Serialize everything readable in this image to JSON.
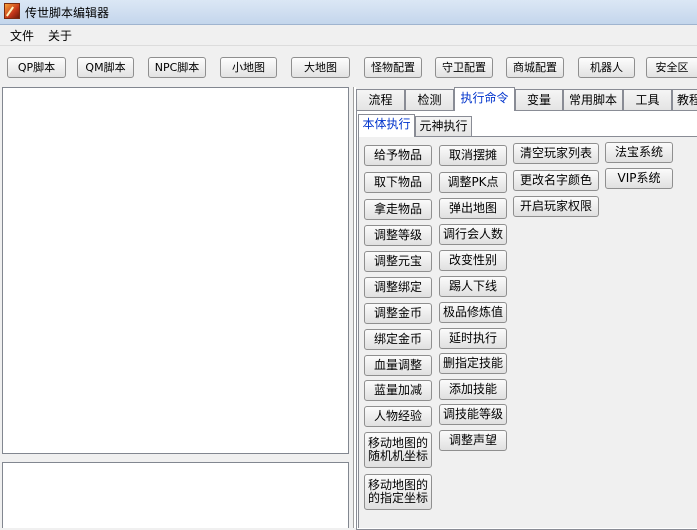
{
  "window": {
    "title": "传世脚本编辑器"
  },
  "menu": {
    "file": "文件",
    "about": "关于"
  },
  "toolbar": [
    "QP脚本",
    "QM脚本",
    "NPC脚本",
    "小地图",
    "大地图",
    "怪物配置",
    "守卫配置",
    "商城配置",
    "机器人",
    "安全区"
  ],
  "tabs": [
    {
      "label": "流程"
    },
    {
      "label": "检测"
    },
    {
      "label": "执行命令"
    },
    {
      "label": "变量"
    },
    {
      "label": "常用脚本"
    },
    {
      "label": "工具"
    },
    {
      "label": "教程"
    }
  ],
  "subtabs": [
    {
      "label": "本体执行"
    },
    {
      "label": "元神执行"
    }
  ],
  "commands": {
    "col1": [
      "给予物品",
      "取下物品",
      "拿走物品",
      "调整等级",
      "调整元宝",
      "调整绑定",
      "调整金币",
      "绑定金币",
      "血量调整",
      "蓝量加减",
      "人物经验",
      "移动地图的随机机坐标",
      "移动地图的的指定坐标"
    ],
    "col2": [
      "取消摆摊",
      "调整PK点",
      "弹出地图",
      "调行会人数",
      "改变性别",
      "踢人下线",
      "极品修炼值",
      "延时执行",
      "删指定技能",
      "添加技能",
      "调技能等级",
      "调整声望"
    ],
    "col3": [
      "清空玩家列表",
      "更改名字颜色",
      "开启玩家权限"
    ],
    "col4": [
      "法宝系统",
      "VIP系统"
    ]
  }
}
